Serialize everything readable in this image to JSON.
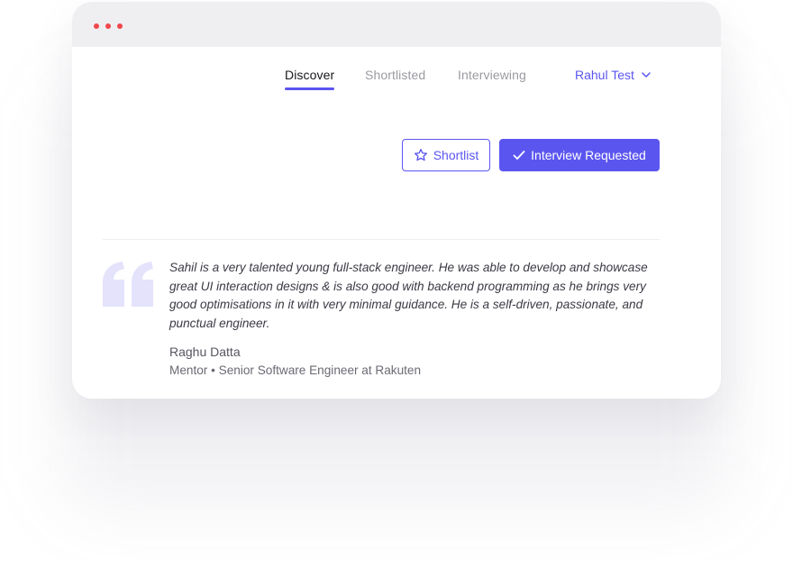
{
  "nav": {
    "tabs": [
      {
        "label": "Discover",
        "active": true
      },
      {
        "label": "Shortlisted",
        "active": false
      },
      {
        "label": "Interviewing",
        "active": false
      }
    ],
    "user": {
      "name": "Rahul Test",
      "icon": "chevron-down-icon"
    }
  },
  "actions": {
    "shortlist": {
      "label": "Shortlist",
      "icon": "star-icon"
    },
    "interview": {
      "label": "Interview Requested",
      "icon": "check-icon"
    }
  },
  "testimonial": {
    "quote": "Sahil is a very talented young full-stack engineer. He was able to develop and showcase great UI interaction designs & is also good with backend programming as he brings very good optimisations in it with very minimal guidance. He is a self-driven, passionate, and punctual engineer.",
    "author": "Raghu Datta",
    "role": "Mentor • Senior Software Engineer at Rakuten"
  },
  "colors": {
    "accent": "#5b55f0",
    "window_dots": "#f0474c",
    "quote_mark": "#e4e3fb",
    "titlebar": "#efeff1"
  }
}
